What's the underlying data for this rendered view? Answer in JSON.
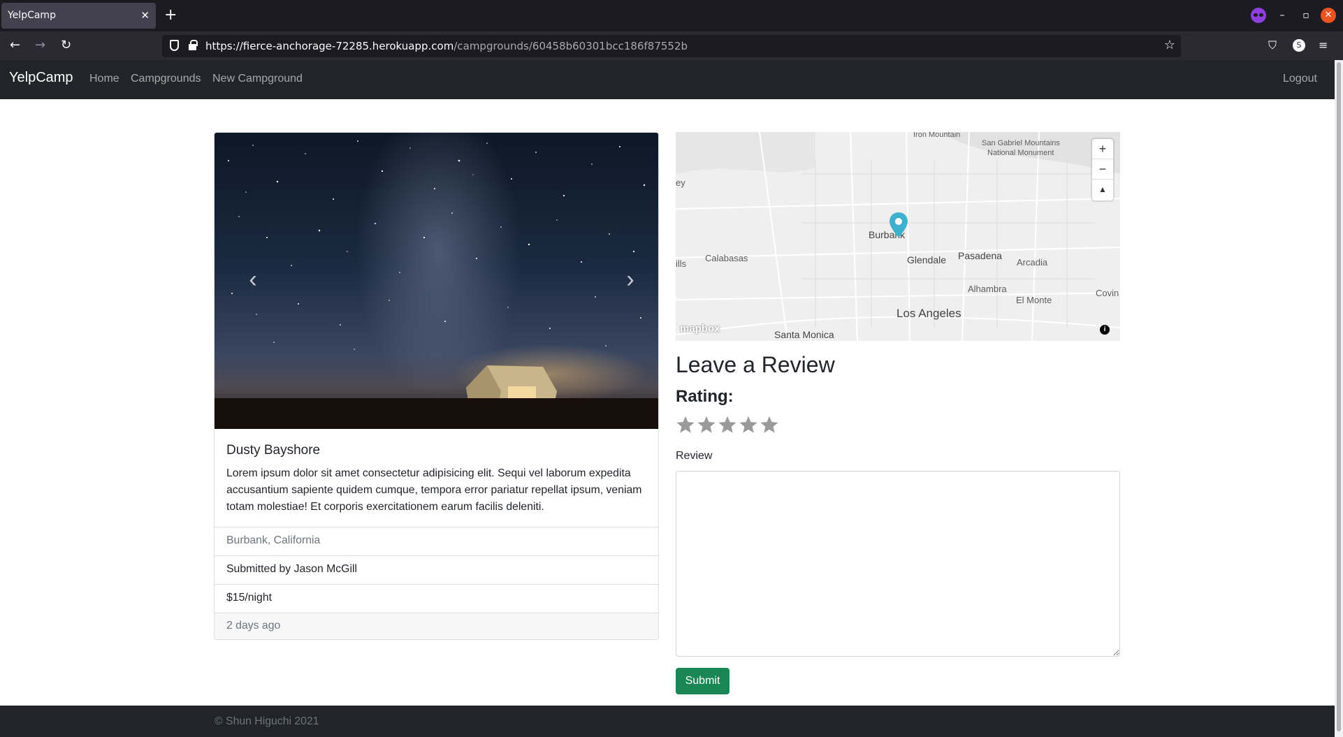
{
  "browser": {
    "tab_title": "YelpCamp",
    "tab_close": "✕",
    "new_tab": "+",
    "url_host": "https://fierce-anchorage-72285.herokuapp.com",
    "url_path": "/campgrounds/60458b60301bcc186f87552b",
    "account_initial": "S",
    "window_controls": {
      "minimize": "–",
      "maximize": "▫",
      "close": "✕"
    }
  },
  "nav": {
    "brand": "YelpCamp",
    "links": [
      "Home",
      "Campgrounds",
      "New Campground"
    ],
    "logout": "Logout"
  },
  "campground": {
    "title": "Dusty Bayshore",
    "description": "Lorem ipsum dolor sit amet consectetur adipisicing elit. Sequi vel laborum expedita accusantium sapiente quidem cumque, tempora error pariatur repellat ipsum, veniam totam molestiae! Et corporis exercitationem earum facilis deleniti.",
    "location": "Burbank, California",
    "submitted_by": "Submitted by Jason McGill",
    "price": "$15/night",
    "posted": "2 days ago",
    "carousel_prev": "‹",
    "carousel_next": "›"
  },
  "map": {
    "labels": {
      "iron_mountain": "Iron Mountain",
      "sgm_1": "San Gabriel Mountains",
      "sgm_2": "National Monument",
      "ey": "ey",
      "ills": "ills",
      "calabasas": "Calabasas",
      "burbank": "Burbank",
      "glendale": "Glendale",
      "pasadena": "Pasadena",
      "arcadia": "Arcadia",
      "alhambra": "Alhambra",
      "el_monte": "El Monte",
      "covin": "Covin",
      "los_angeles": "Los Angeles",
      "santa_monica": "Santa Monica"
    },
    "zoom_in": "+",
    "zoom_out": "−",
    "compass": "▲",
    "logo": "mapbox",
    "info": "i",
    "marker_color": "#3fb1ce"
  },
  "review_form": {
    "title": "Leave a Review",
    "rating_label": "Rating:",
    "rating_value": 0,
    "rating_max": 5,
    "review_label": "Review",
    "review_value": "",
    "submit": "Submit"
  },
  "footer": {
    "text": "© Shun Higuchi 2021"
  }
}
